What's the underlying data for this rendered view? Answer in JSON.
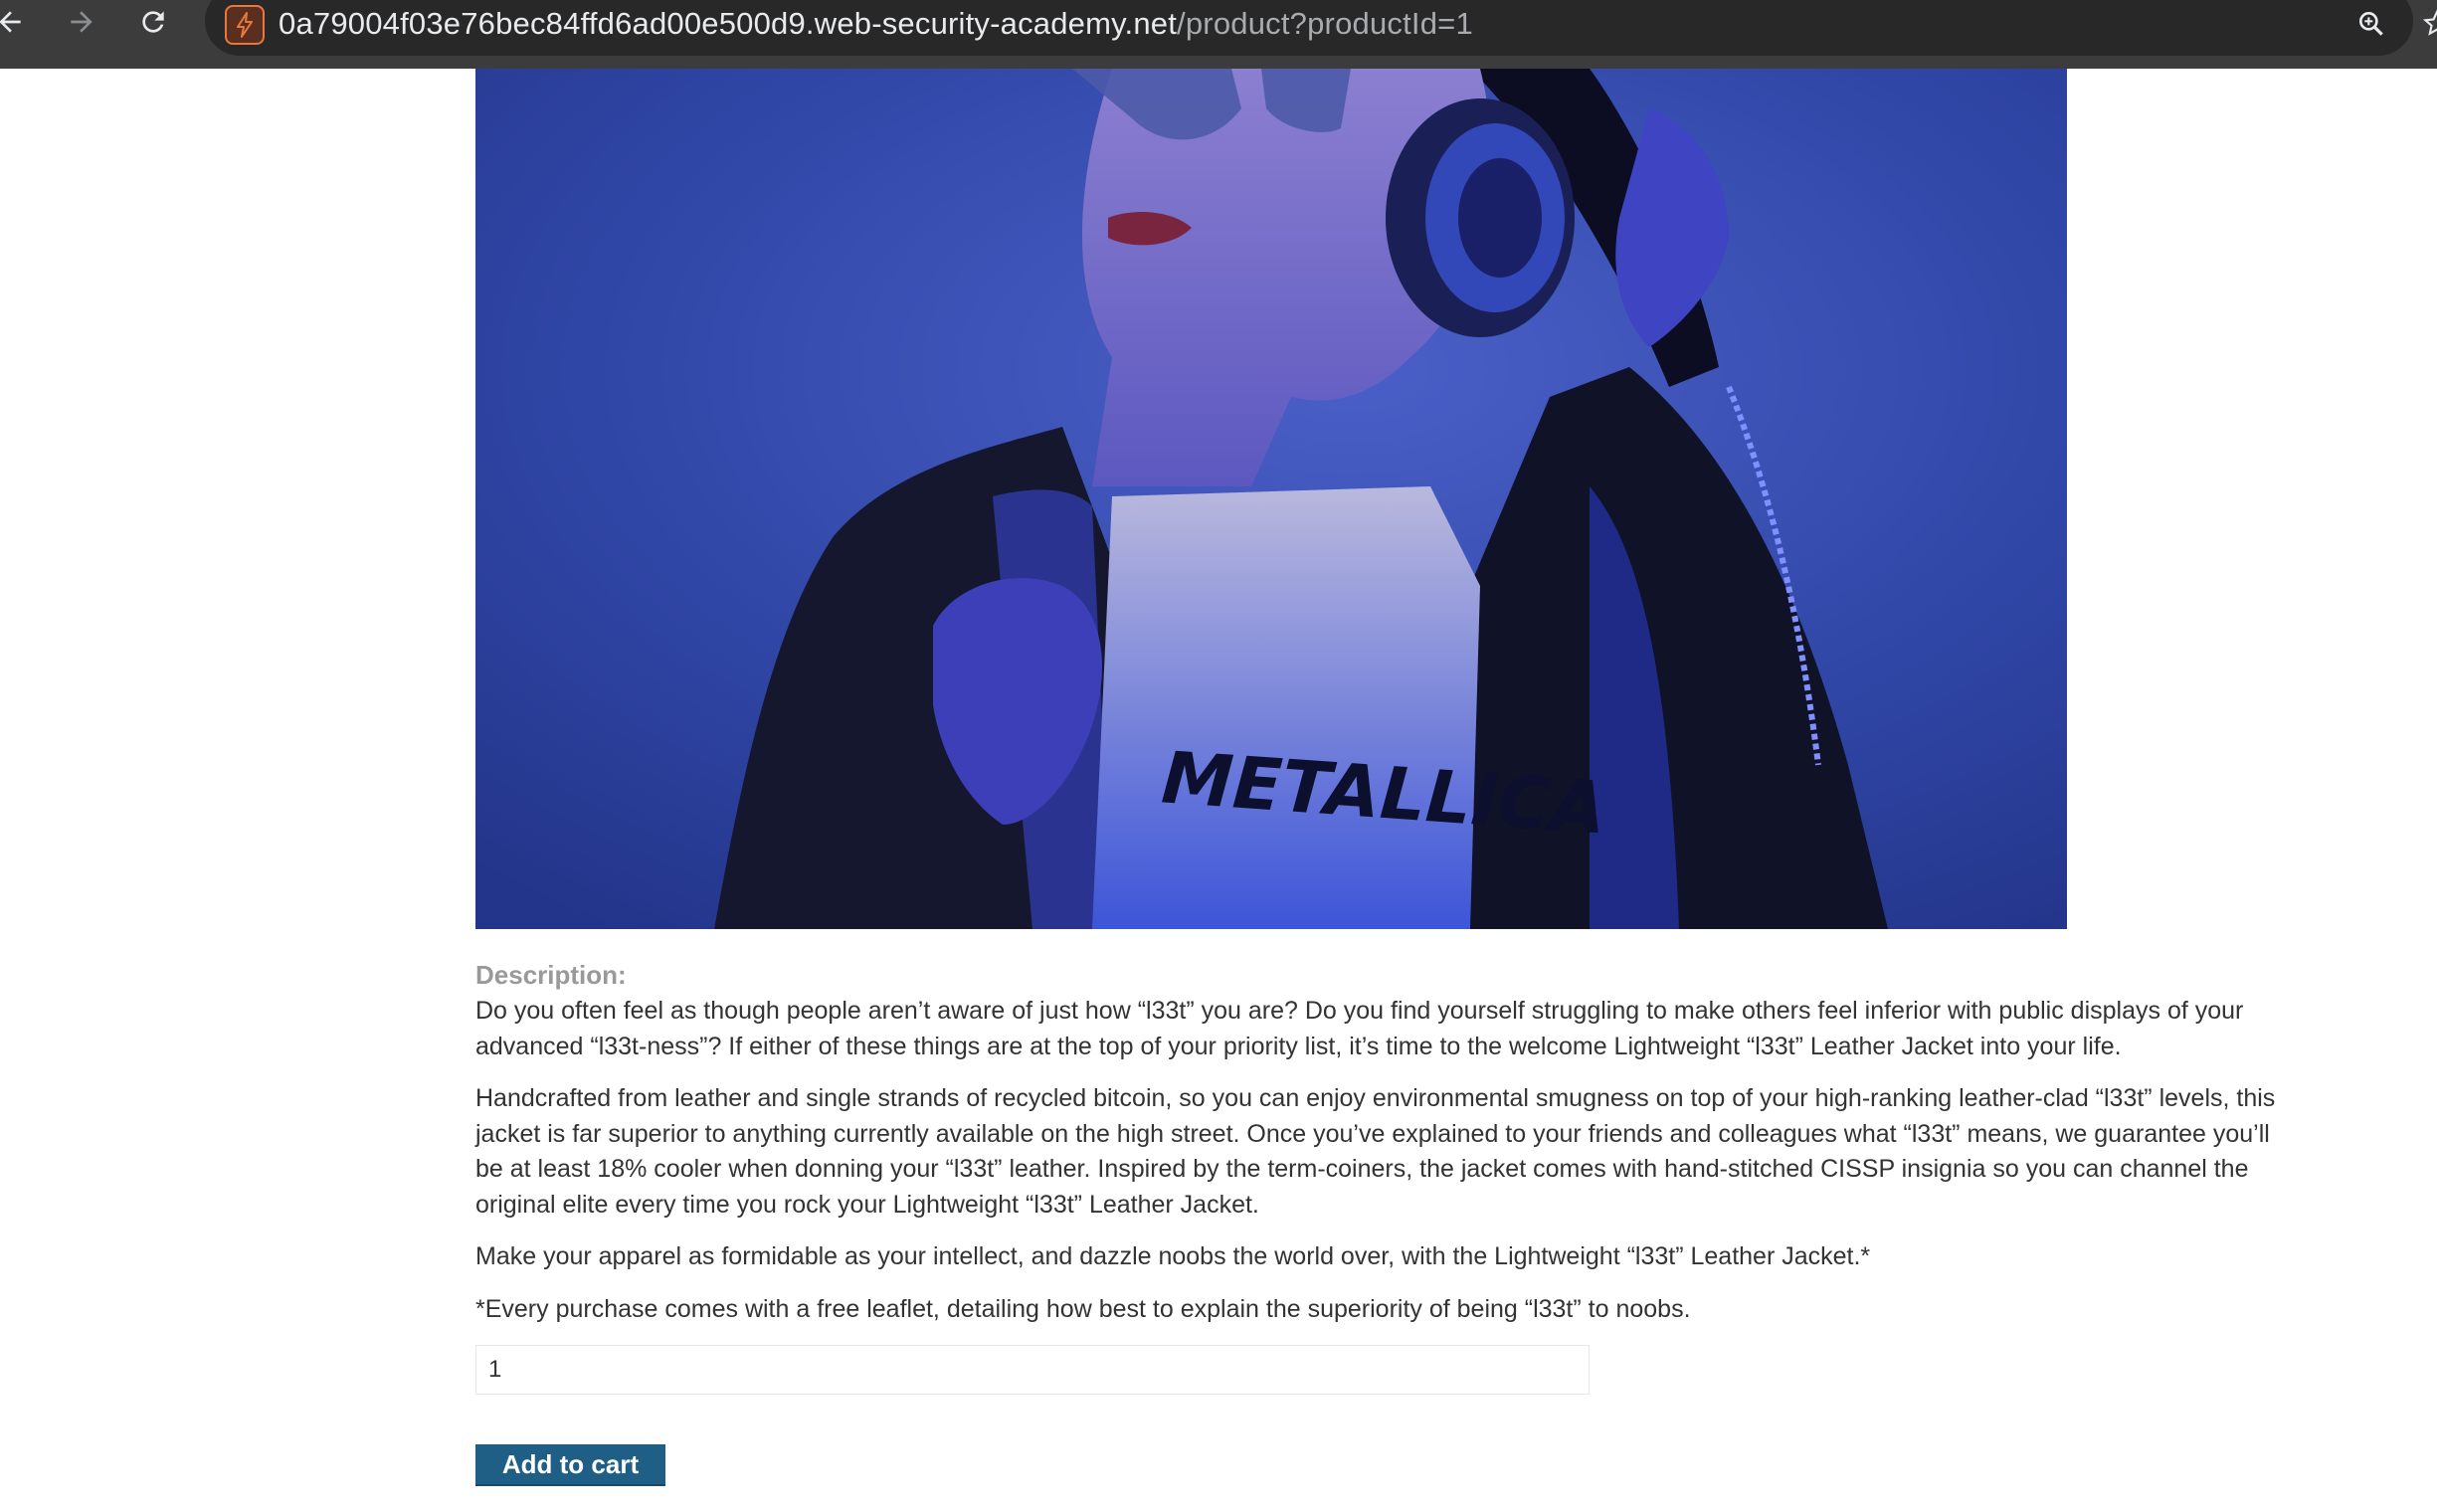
{
  "browser": {
    "url_host": "0a79004f03e76bec84ffd6ad00e500d9.web-security-academy.net",
    "url_path": "/product?productId=1",
    "icons": [
      "back-icon",
      "forward-icon",
      "reload-icon",
      "site-info-icon",
      "zoom-icon",
      "bookmark-star-icon"
    ]
  },
  "product": {
    "image_shirt_text": "METALLICA",
    "description_label": "Description:",
    "paragraphs": [
      "Do you often feel as though people aren’t aware of just how “l33t” you are? Do you find yourself struggling to make others feel inferior with public displays of your advanced “l33t-ness”? If either of these things are at the top of your priority list, it’s time to the welcome Lightweight “l33t” Leather Jacket into your life.",
      "Handcrafted from leather and single strands of recycled bitcoin, so you can enjoy environmental smugness on top of your high-ranking leather-clad “l33t” levels, this jacket is far superior to anything currently available on the high street. Once you’ve explained to your friends and colleagues what “l33t” means, we guarantee you’ll be at least 18% cooler when donning your “l33t” leather. Inspired by the term-coiners, the jacket comes with hand-stitched CISSP insignia so you can channel the original elite every time you rock your Lightweight “l33t” Leather Jacket.",
      "Make your apparel as formidable as your intellect, and dazzle noobs the world over, with the Lightweight “l33t” Leather Jacket.*",
      "*Every purchase comes with a free leaflet, detailing how best to explain the superiority of being “l33t” to noobs."
    ],
    "quantity": "1",
    "add_to_cart_label": "Add to cart"
  },
  "colors": {
    "chrome": "#3c3c3c",
    "omnibox": "#282828",
    "button": "#1f5f86",
    "label": "#999999",
    "text": "#333333"
  }
}
